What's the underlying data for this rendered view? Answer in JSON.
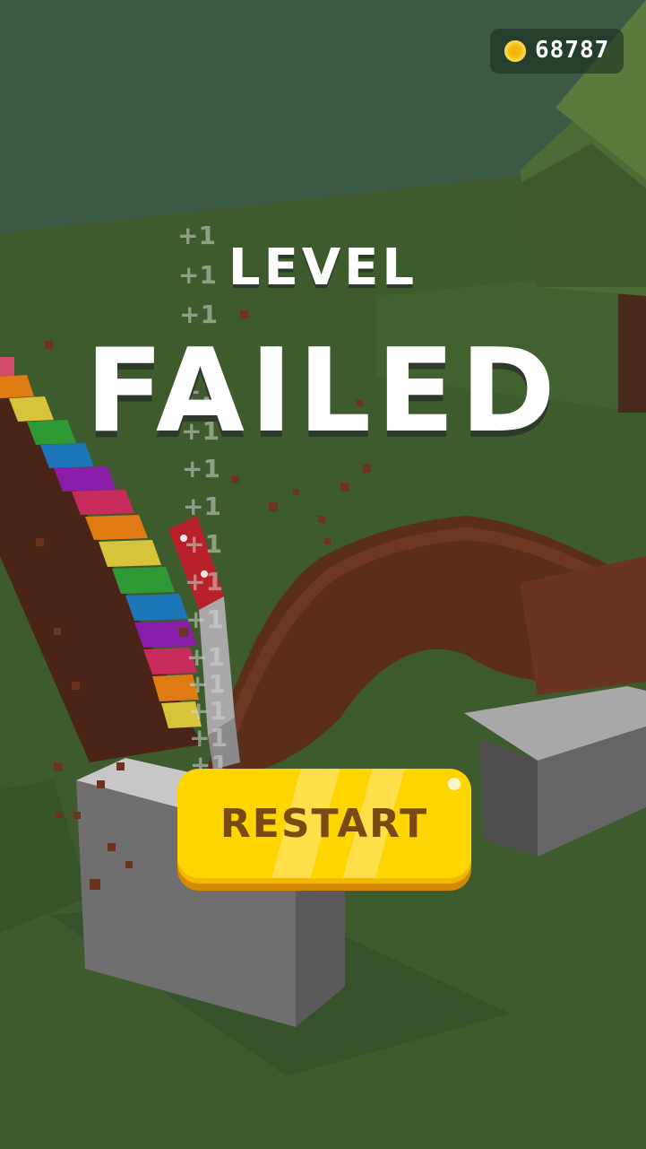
{
  "hud": {
    "coins": "68787",
    "coin_icon": "coin-icon"
  },
  "result": {
    "line1": "LEVEL",
    "line2": "FAILED"
  },
  "score_popups": [
    "+1",
    "+1",
    "+1",
    "+1",
    "+1",
    "+1",
    "+1",
    "+1",
    "+1",
    "+1",
    "+1",
    "+1",
    "+1",
    "+1",
    "+1"
  ],
  "actions": {
    "restart_label": "RESTART"
  },
  "colors": {
    "grass": "#3d5a2f",
    "button": "#ffd500",
    "button_text": "#7a4a12",
    "wood": "#5a2d1c"
  }
}
